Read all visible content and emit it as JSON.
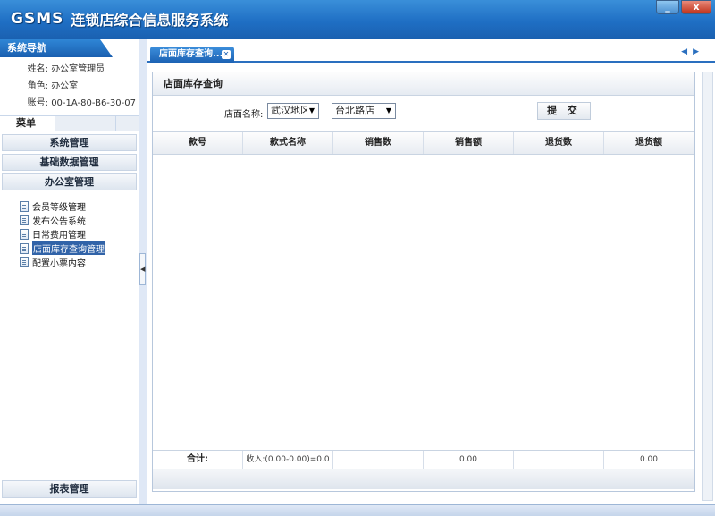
{
  "app": {
    "logo_mark": "GSMS",
    "title": "连锁店综合信息服务系统",
    "window_controls": {
      "minimize": "_",
      "close": "x"
    }
  },
  "sidebar": {
    "header": "系统导航",
    "user": [
      {
        "label": "姓名:",
        "value": "办公室管理员"
      },
      {
        "label": "角色:",
        "value": "办公室"
      },
      {
        "label": "账号:",
        "value": "00-1A-80-B6-30-07"
      }
    ],
    "menu_tab": "菜单",
    "categories": [
      "系统管理",
      "基础数据管理",
      "办公室管理"
    ],
    "items": [
      {
        "label": "会员等级管理",
        "selected": false
      },
      {
        "label": "发布公告系统",
        "selected": false
      },
      {
        "label": "日常费用管理",
        "selected": false
      },
      {
        "label": "店面库存查询管理",
        "selected": true
      },
      {
        "label": "配置小票内容",
        "selected": false
      }
    ],
    "bottom_category": "报表管理",
    "collapse_icon": "chevron-left-icon"
  },
  "tabs": [
    {
      "label": "店面库存查询...",
      "active": true
    }
  ],
  "panel": {
    "title": "店面库存查询",
    "store_label": "店面名称:",
    "region_select": "武汉地区",
    "store_select": "台北路店",
    "submit": "提 交",
    "columns": [
      "款号",
      "款式名称",
      "销售数",
      "销售额",
      "退货数",
      "退货额"
    ],
    "footer": {
      "total_label": "合计:",
      "income": "收入:(0.00-0.00)=0.0",
      "sales_amount": "0.00",
      "return_amount": "0.00"
    }
  },
  "colors": {
    "banner": "#1f6fc4",
    "selected_item": "#3163a8",
    "tab": "#1c62b4"
  }
}
